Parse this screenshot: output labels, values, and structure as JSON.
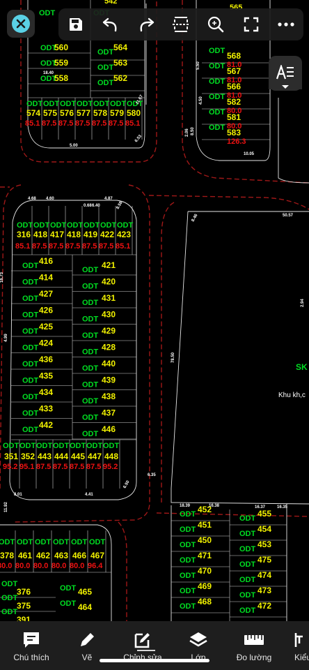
{
  "toolbar": {
    "close": "close-icon",
    "save": "save-icon",
    "undo": "undo-icon",
    "redo": "redo-icon",
    "fit": "fit-icon",
    "zoom": "zoom-icon",
    "fullscreen": "fullscreen-icon",
    "more": "more-icon",
    "text_toggle": "text-size-icon"
  },
  "colors": {
    "background": "#000000",
    "road_edge": "#a01818",
    "block_outline": "#e6e6e6",
    "land_use_code": "#00dd22",
    "lot_number": "#f2f200",
    "lot_area": "#ee1111",
    "dimension": "#ffffff",
    "accent": "#5ad1e6"
  },
  "drawing": {
    "land_use_code": "ODT",
    "zone_code_partial": "SK",
    "zone_label_partial": "Khu kh,c",
    "dimensions": [
      "50.57",
      "78.50",
      "8.46",
      "2.94",
      "11.67",
      "6.53",
      "18.39",
      "18.40",
      "10.05",
      "2.06",
      "5.00",
      "4.50",
      "4.99",
      "5.50",
      "0.68",
      "16.73",
      "8.01",
      "4.41",
      "4.68",
      "8.58",
      "11.92",
      "6.35",
      "4.60",
      "4.87",
      "8.50",
      "6.50",
      "6.40",
      "16.37",
      "16.38",
      "16.35"
    ],
    "top_left_block": {
      "lots_col_a": [
        "560",
        "559",
        "558"
      ],
      "lots_col_b": [
        "564",
        "563",
        "562"
      ],
      "partial_top": "542",
      "bottom_row": [
        "574",
        "575",
        "576",
        "577",
        "578",
        "579",
        "580"
      ],
      "bottom_row_area": [
        "85.1",
        "87.5",
        "87.5",
        "87.5",
        "87.5",
        "87.5",
        "85.1"
      ]
    },
    "top_right_block": {
      "lots": [
        "568",
        "567",
        "566",
        "582",
        "581",
        "583"
      ],
      "partial_top": "565",
      "areas": [
        "81.0",
        "81.0",
        "81.0",
        "80.0",
        "80.0",
        "126.3"
      ]
    },
    "middle_left_block": {
      "top_row": [
        "316",
        "418",
        "417",
        "418",
        "419",
        "422",
        "423"
      ],
      "top_row_area": [
        "85.1",
        "87.5",
        "87.5",
        "87.5",
        "87.5",
        "87.5",
        "85.1"
      ],
      "col_left": [
        "416",
        "414",
        "427",
        "426",
        "425",
        "424",
        "436",
        "435",
        "434",
        "433",
        "442"
      ],
      "col_right": [
        "421",
        "420",
        "431",
        "430",
        "429",
        "428",
        "440",
        "439",
        "438",
        "437",
        "446"
      ],
      "bottom_row": [
        "351",
        "352",
        "443",
        "444",
        "445",
        "447",
        "448"
      ],
      "bottom_row_area": [
        "95.2",
        "95.1",
        "87.5",
        "87.5",
        "87.5",
        "87.5",
        "95.2"
      ]
    },
    "bottom_left_block": {
      "top_row": [
        "378",
        "461",
        "462",
        "463",
        "466",
        "467"
      ],
      "top_row_area": [
        "80.0",
        "80.0",
        "80.0",
        "80.0",
        "80.0",
        "96.4"
      ],
      "rows": [
        "376",
        "375",
        "391"
      ],
      "col_right": [
        "465",
        "464"
      ]
    },
    "bottom_right_block": {
      "col_left": [
        "452",
        "451",
        "450",
        "471",
        "470",
        "469",
        "468"
      ],
      "col_right": [
        "455",
        "454",
        "453",
        "475",
        "474",
        "473",
        "472"
      ]
    }
  },
  "bottom_tools": [
    {
      "id": "annotation",
      "label": "Chú thích",
      "icon": "comment-icon"
    },
    {
      "id": "draw",
      "label": "Vẽ",
      "icon": "pencil-icon"
    },
    {
      "id": "edit",
      "label": "Chỉnh sửa",
      "icon": "edit-icon"
    },
    {
      "id": "layers",
      "label": "Lớp",
      "icon": "layers-icon"
    },
    {
      "id": "measure",
      "label": "Đo lường",
      "icon": "ruler-icon"
    },
    {
      "id": "style",
      "label": "Kiểu",
      "icon": "style-icon"
    }
  ]
}
